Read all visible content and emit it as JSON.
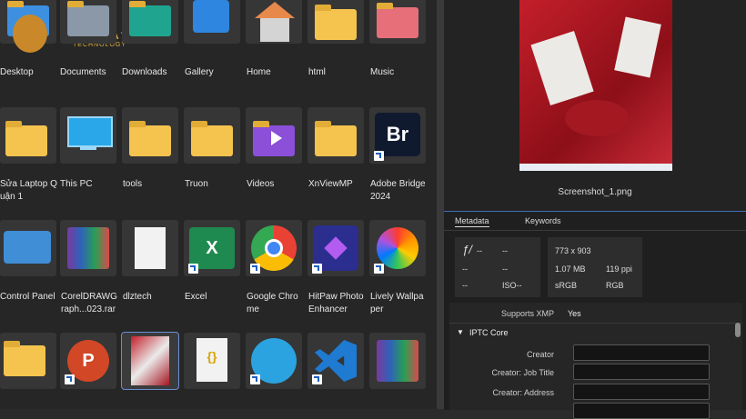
{
  "left": {
    "items": [
      {
        "label": "Desktop"
      },
      {
        "label": "Documents"
      },
      {
        "label": "Downloads"
      },
      {
        "label": "Gallery"
      },
      {
        "label": "Home"
      },
      {
        "label": "html"
      },
      {
        "label": "Music"
      },
      {
        "label": "Sửa Laptop Q uận 1"
      },
      {
        "label": "This PC"
      },
      {
        "label": "tools"
      },
      {
        "label": "Truon"
      },
      {
        "label": "Videos"
      },
      {
        "label": "XnViewMP"
      },
      {
        "label": "Adobe Bridge 2024"
      },
      {
        "label": "Control Panel"
      },
      {
        "label": "CorelDRAWG raph...023.rar"
      },
      {
        "label": "dlztech"
      },
      {
        "label": "Excel"
      },
      {
        "label": "Google Chro me"
      },
      {
        "label": "HitPaw Photo Enhancer"
      },
      {
        "label": "Lively Wallpa per"
      }
    ],
    "watermark_main": "FIX NGAY",
    "watermark_sub": "TECHNOLOGY"
  },
  "right": {
    "filename": "Screenshot_1.png",
    "tabs": {
      "metadata": "Metadata",
      "keywords": "Keywords"
    },
    "summary": {
      "fstop": "ƒ/",
      "dash": "--",
      "iso": "ISO--",
      "dims": "773 x 903",
      "size": "1.07 MB",
      "ppi": "119 ppi",
      "cs": "sRGB",
      "mode": "RGB"
    },
    "supports_label": "Supports XMP",
    "supports_value": "Yes",
    "section": "IPTC Core",
    "fields": [
      "Creator",
      "Creator: Job Title",
      "Creator: Address"
    ]
  },
  "colors": {
    "accent": "#3d6fb8",
    "folder": "#f4c44e"
  }
}
